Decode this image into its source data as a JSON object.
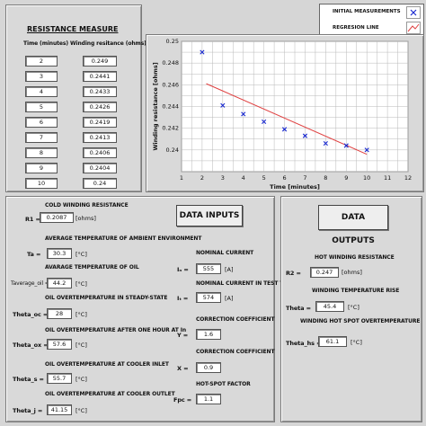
{
  "resistance_measure": {
    "title": "RESISTANCE MEASURE",
    "time_header": "Time (minutes)",
    "winding_header": "Winding resitance (ohms)",
    "times": [
      "2",
      "3",
      "4",
      "5",
      "6",
      "7",
      "8",
      "9",
      "10"
    ],
    "resistances": [
      "0.249",
      "0.2441",
      "0.2433",
      "0.2426",
      "0.2419",
      "0.2413",
      "0.2406",
      "0.2404",
      "0.24"
    ]
  },
  "legend": {
    "initial_label": "INITIAL MEASUREMENTS",
    "regression_label": "REGRESION LINE"
  },
  "chart_data": {
    "type": "scatter",
    "xlabel": "Time [minutes]",
    "ylabel": "Winding resistance [ohms]",
    "xlim": [
      1,
      12
    ],
    "ylim": [
      0.238,
      0.25
    ],
    "x_ticks": [
      "1",
      "2",
      "3",
      "4",
      "5",
      "6",
      "7",
      "8",
      "9",
      "10",
      "11",
      "12"
    ],
    "y_ticks": [
      "0.25",
      "0.248",
      "0.246",
      "0.244",
      "0.242",
      "0.24"
    ],
    "grid": true,
    "series": [
      {
        "name": "INITIAL MEASUREMENTS",
        "type": "scatter",
        "x": [
          2,
          3,
          4,
          5,
          6,
          7,
          8,
          9,
          10
        ],
        "y": [
          0.249,
          0.2441,
          0.2433,
          0.2426,
          0.2419,
          0.2413,
          0.2406,
          0.2404,
          0.24
        ],
        "color": "#1a2ad0"
      },
      {
        "name": "REGRESION LINE",
        "type": "line",
        "x": [
          2.2,
          10
        ],
        "y": [
          0.2461,
          0.2396
        ],
        "color": "#e04040"
      }
    ]
  },
  "inputs": {
    "title": "DATA INPUTS",
    "cold_resistance_label": "COLD WINDING RESISTANCE",
    "r1_label": "R1 =",
    "r1_value": "0.2087",
    "r1_unit": "[ohms]",
    "ambient_label": "AVERAGE TEMPERATURE OF AMBIENT ENVIRONMENT",
    "ta_label": "Ta =",
    "ta_value": "30.3",
    "ta_unit": "[°C]",
    "oil_avg_label": "AVARAGE TEMPERATURE OF OIL",
    "toil_label": "Taverage_oil =",
    "toil_value": "44.2",
    "toil_unit": "[°C]",
    "oil_over_steady_label": "OIL OVERTEMPERATURE IN STEADY-STATE",
    "theta_oc_label": "Theta_oc =",
    "theta_oc_value": "28",
    "theta_oc_unit": "[°C]",
    "oil_over_hour_label": "OIL OVERTEMPERATURE AFTER ONE HOUR AT In",
    "theta_ox_label": "Theta_ox =",
    "theta_ox_value": "57.6",
    "theta_ox_unit": "[°C]",
    "cooler_inlet_label": "OIL OVERTEMPERATURE AT COOLER INLET",
    "theta_s_label": "Theta_s =",
    "theta_s_value": "55.7",
    "theta_s_unit": "[°C]",
    "cooler_outlet_label": "OIL OVERTEMPERATURE AT COOLER OUTLET",
    "theta_j_label": "Theta_j =",
    "theta_j_value": "41.15",
    "theta_j_unit": "[°C]",
    "nominal_current_label": "NOMINAL CURRENT",
    "in_label": "Iₙ =",
    "in_value": "555",
    "in_unit": "[A]",
    "test_current_label": "NOMINAL CURRENT IN TEST TIME",
    "it_label": "Iₜ =",
    "it_value": "574",
    "it_unit": "[A]",
    "corr_y_label": "CORRECTION COEFFICIENT",
    "y_label": "Y =",
    "y_value": "1.6",
    "corr_x_label": "CORRECTION COEFFICIENT",
    "x_label": "X =",
    "x_value": "0.9",
    "hotspot_factor_label": "HOT-SPOT FACTOR",
    "fpc_label": "Fpc =",
    "fpc_value": "1.1"
  },
  "outputs": {
    "title": "DATA OUTPUTS",
    "hot_resistance_label": "HOT WINDING RESISTANCE",
    "r2_label": "R2 =",
    "r2_value": "0.247",
    "r2_unit": "[ohms]",
    "winding_rise_label": "WINDING TEMPERATURE RISE",
    "theta_label": "Theta =",
    "theta_value": "45.4",
    "theta_unit": "[°C]",
    "hotspot_label": "WINDING HOT SPOT OVERTEMPERATURE",
    "theta_hs_label": "Theta_hs =",
    "theta_hs_value": "61.1",
    "theta_hs_unit": "[°C]"
  }
}
